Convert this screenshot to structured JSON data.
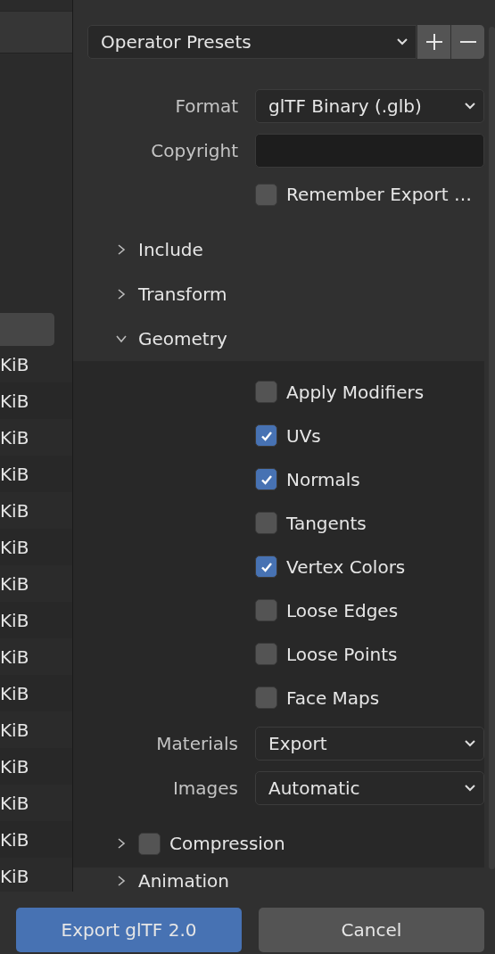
{
  "file_list": {
    "rows": [
      {
        "size": "KiB"
      },
      {
        "size": "KiB"
      },
      {
        "size": "KiB"
      },
      {
        "size": "KiB"
      },
      {
        "size": "KiB"
      },
      {
        "size": "KiB"
      },
      {
        "size": "KiB"
      },
      {
        "size": "KiB"
      },
      {
        "size": "KiB"
      },
      {
        "size": "KiB"
      },
      {
        "size": "KiB"
      },
      {
        "size": "KiB"
      },
      {
        "size": "KiB"
      },
      {
        "size": "KiB"
      },
      {
        "size": "KiB"
      }
    ]
  },
  "operator_presets": {
    "value": "Operator Presets"
  },
  "settings": [
    {
      "kind": "dropdown",
      "label": "Format",
      "value": "glTF Binary (.glb)"
    },
    {
      "kind": "text",
      "label": "Copyright"
    },
    {
      "kind": "checkbox",
      "label": "Remember Export …",
      "checked": false
    }
  ],
  "sections": [
    {
      "title": "Include",
      "expanded": false
    },
    {
      "title": "Transform",
      "expanded": false
    },
    {
      "title": "Geometry",
      "expanded": true,
      "items": [
        {
          "kind": "checkbox",
          "label": "Apply Modifiers",
          "checked": false
        },
        {
          "kind": "checkbox",
          "label": "UVs",
          "checked": true
        },
        {
          "kind": "checkbox",
          "label": "Normals",
          "checked": true
        },
        {
          "kind": "checkbox",
          "label": "Tangents",
          "checked": false
        },
        {
          "kind": "checkbox",
          "label": "Vertex Colors",
          "checked": true
        },
        {
          "kind": "checkbox",
          "label": "Loose Edges",
          "checked": false
        },
        {
          "kind": "checkbox",
          "label": "Loose Points",
          "checked": false
        },
        {
          "kind": "checkbox",
          "label": "Face Maps",
          "checked": false
        },
        {
          "kind": "dropdown",
          "label": "Materials",
          "value": "Export"
        },
        {
          "kind": "dropdown",
          "label": "Images",
          "value": "Automatic"
        }
      ],
      "subsections": [
        {
          "title": "Compression",
          "expanded": false,
          "checked": false
        }
      ]
    },
    {
      "title": "Animation",
      "expanded": false
    }
  ],
  "buttons": [
    {
      "kind": "primary",
      "label": "Export glTF 2.0"
    },
    {
      "kind": "secondary",
      "label": "Cancel"
    }
  ]
}
